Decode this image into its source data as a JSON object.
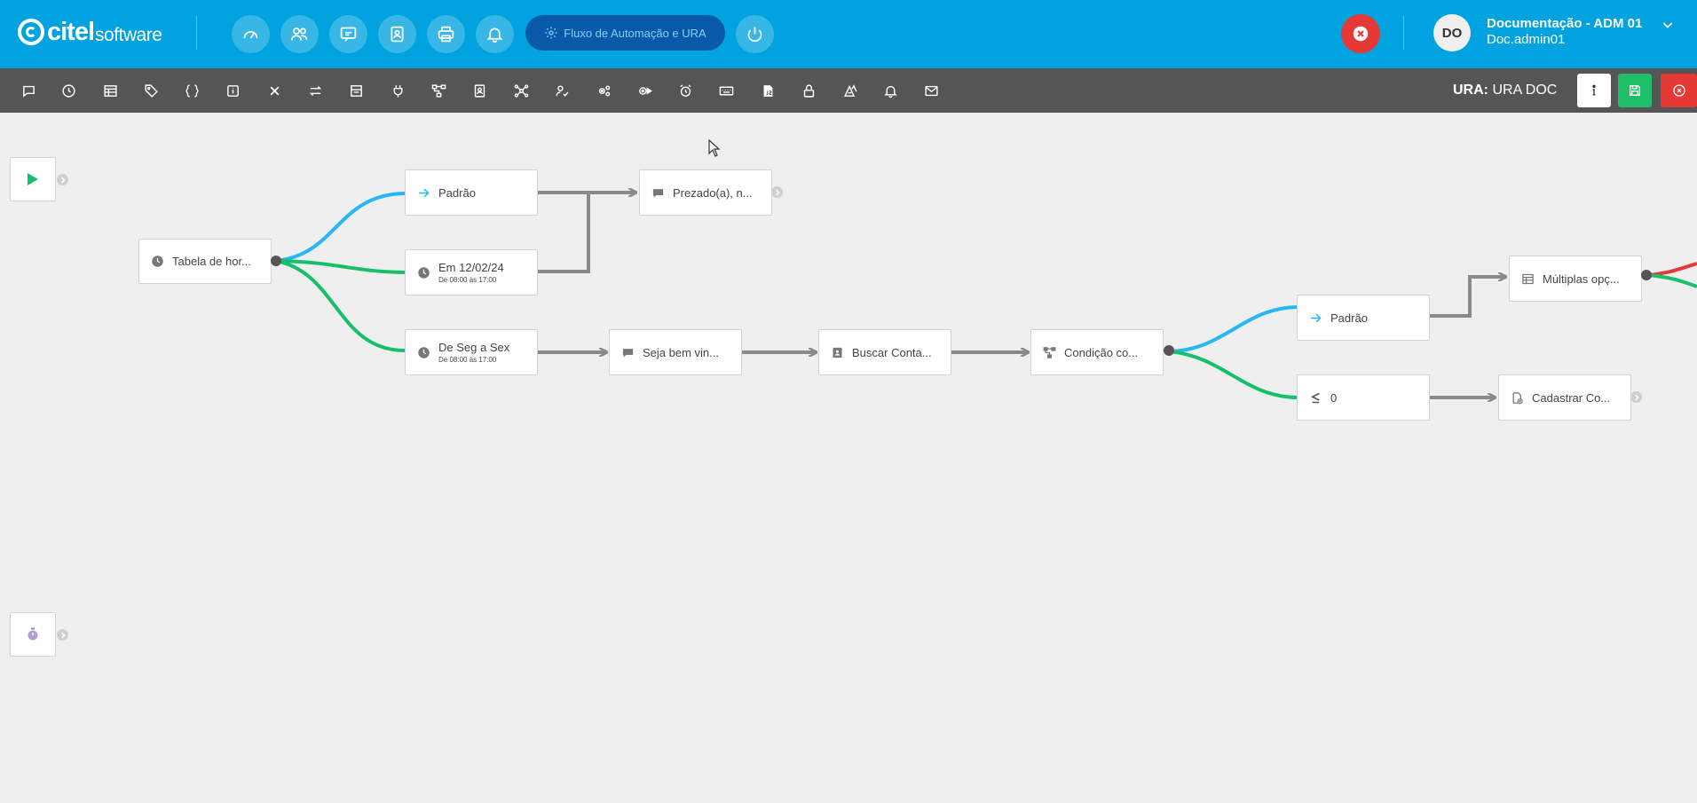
{
  "header": {
    "logo_text": "citel",
    "logo_sub": "software",
    "nav_icons": [
      "dashboard-icon",
      "users-icon",
      "chat-icon",
      "contacts-icon",
      "printer-icon",
      "bell-icon"
    ],
    "active_button_label": "Fluxo de Automação e URA",
    "power_icon": "power-icon",
    "user": {
      "initials": "DO",
      "name": "Documentação - ADM 01",
      "login": "Doc.admin01"
    }
  },
  "toolbar": {
    "tools": [
      "message-icon",
      "clock-icon",
      "table-icon",
      "tag-icon",
      "braces-icon",
      "info-icon",
      "close-icon",
      "transfer-icon",
      "form-icon",
      "plug-icon",
      "branch-icon",
      "contact-book-icon",
      "network-icon",
      "user-check-icon",
      "gears-icon",
      "gear-play-icon",
      "alarm-icon",
      "keyboard-icon",
      "js-file-icon",
      "lock-icon",
      "ai-icon",
      "bell-icon",
      "mail-icon"
    ],
    "ura_prefix": "URA:",
    "ura_name": "URA DOC",
    "colors": {
      "save": "#1fbf6a",
      "close": "#e53935"
    }
  },
  "flow": {
    "nodes": {
      "tabela": "Tabela de hor...",
      "padrao1": "Padrão",
      "em_data": "Em 12/02/24",
      "em_data_sub": "De 08:00 às 17:00",
      "seg_sex": "De Seg a Sex",
      "seg_sex_sub": "De 08:00 às 17:00",
      "prezado": "Prezado(a), n...",
      "seja": "Seja bem vin...",
      "buscar": "Buscar Conta...",
      "condicao": "Condição co...",
      "padrao2": "Padrão",
      "zero": "0",
      "multiplas": "Múltiplas opç...",
      "cadastrar": "Cadastrar Co..."
    },
    "colors": {
      "blue": "#29b6f6",
      "green": "#18bf6b",
      "gray": "#8a8a8a",
      "red": "#e53935"
    }
  }
}
